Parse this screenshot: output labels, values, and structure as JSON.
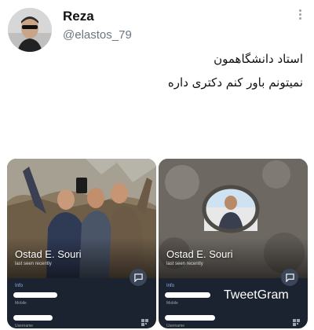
{
  "tweet": {
    "author_name": "Reza",
    "author_handle": "@elastos_79",
    "text_line1": "استاد دانشگاهمون",
    "text_line2": "نمیتونم باور کنم دکتری داره"
  },
  "profile_cards": [
    {
      "display_name": "Ostad E. Souri",
      "status": "last seen recently",
      "info_label": "Info",
      "mobile_label": "Mobile",
      "username_label": "Username"
    },
    {
      "display_name": "Ostad E. Souri",
      "status": "last seen recently",
      "info_label": "Info",
      "mobile_label": "Mobile",
      "username_label": "Username"
    }
  ],
  "watermark": "TweetGram",
  "icons": [
    "more-vertical-icon",
    "message-icon",
    "qr-code-icon"
  ],
  "colors": {
    "panel_bg": "#1c2330",
    "info_accent": "#8fb6f0",
    "handle_gray": "#6b7580"
  }
}
